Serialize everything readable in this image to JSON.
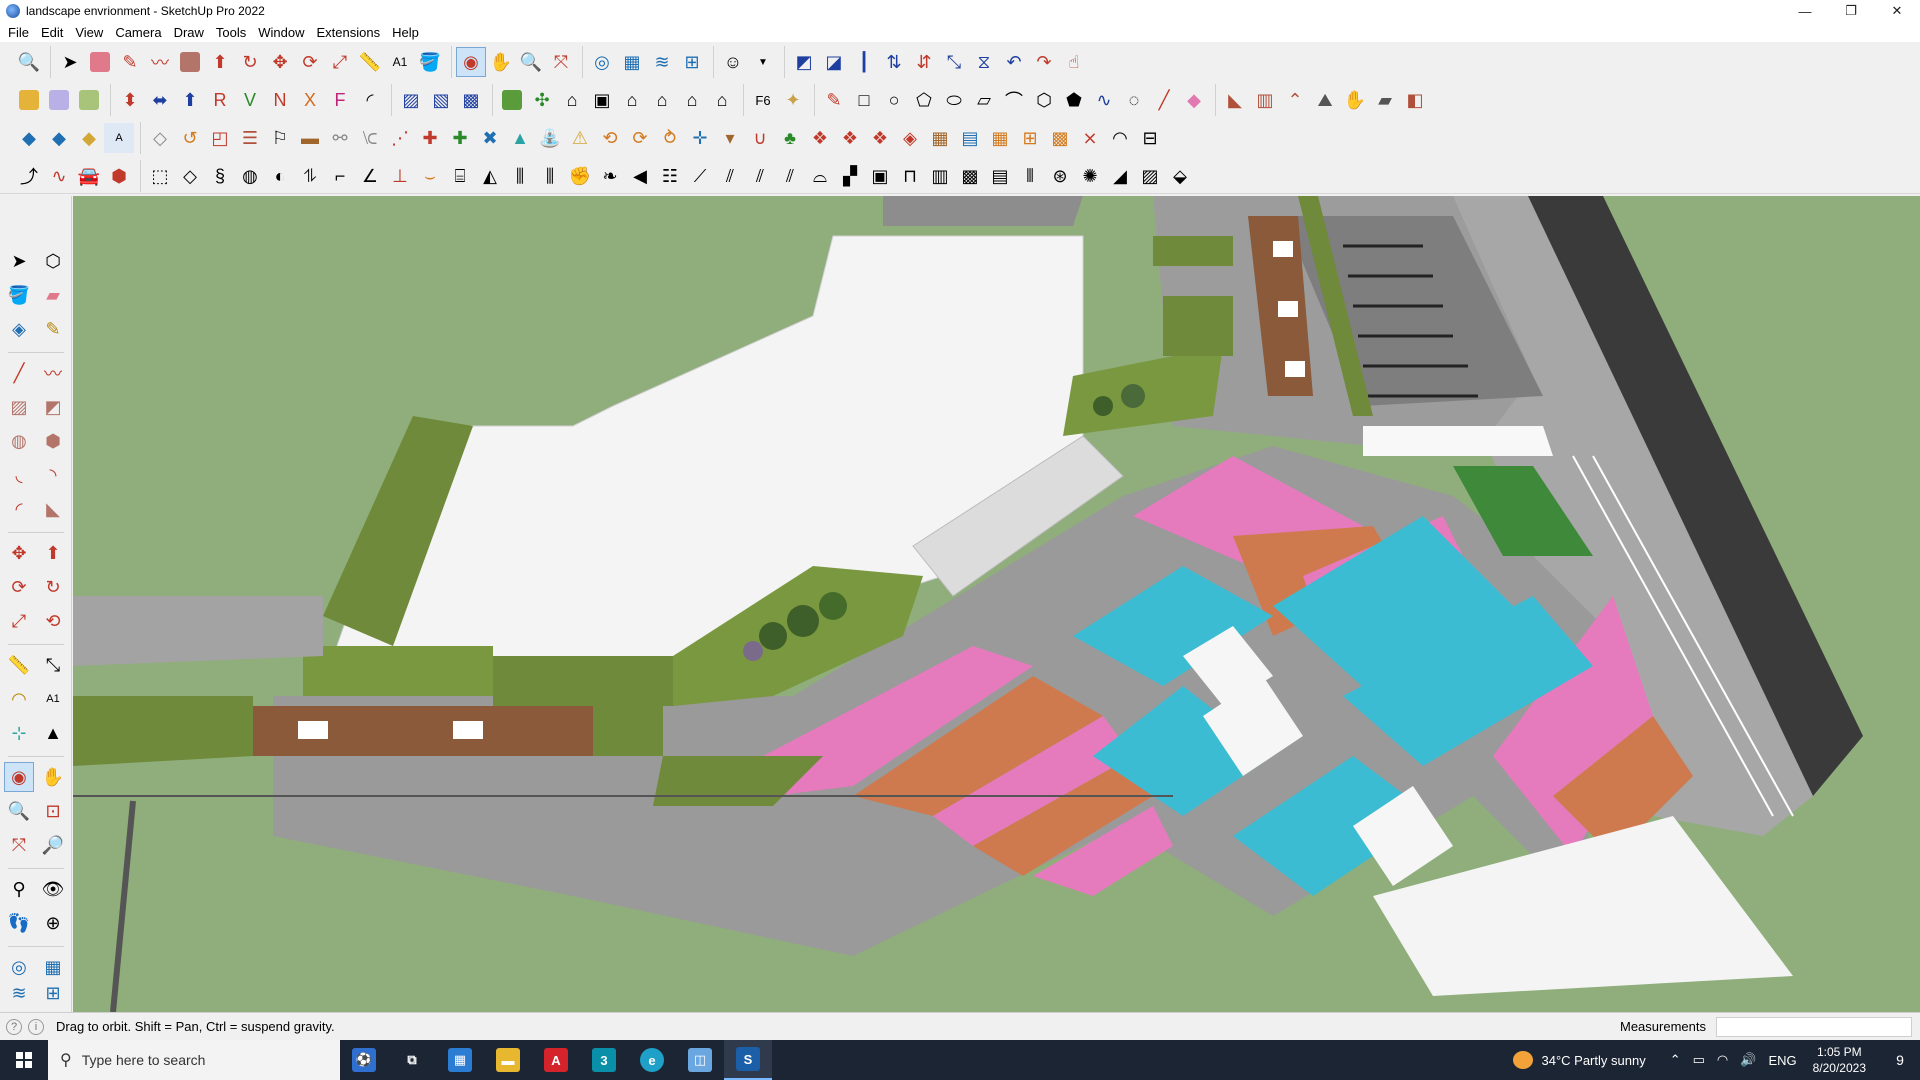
{
  "window": {
    "title": "landscape envrionment - SketchUp Pro 2022",
    "minimize": "—",
    "restore": "❐",
    "close": "✕"
  },
  "menu": [
    "File",
    "Edit",
    "View",
    "Camera",
    "Draw",
    "Tools",
    "Window",
    "Extensions",
    "Help"
  ],
  "status": {
    "hint": "Drag to orbit. Shift = Pan, Ctrl = suspend gravity.",
    "measurements_label": "Measurements",
    "measurements_value": ""
  },
  "taskbar": {
    "search_placeholder": "Type here to search",
    "apps": [
      "widgets",
      "task-view",
      "calculator",
      "file-explorer",
      "acrobat",
      "3ds-max",
      "edge",
      "sketchup-layout",
      "sketchup"
    ],
    "weather_temp": "34°C",
    "weather_text": "Partly sunny",
    "language": "ENG",
    "time": "1:05 PM",
    "date": "8/20/2023",
    "notifications": "9"
  },
  "colors": {
    "ground": "#8fae7b",
    "water": "#3bbcd3",
    "paving_white": "#f4f4f4",
    "road": "#9a9a9a",
    "planter": "#6e8a3a",
    "pink_flowers": "#e57bbd",
    "orange_bed": "#cf7a4e",
    "deck_wood": "#8a5a3a",
    "dark_wall": "#333333"
  }
}
